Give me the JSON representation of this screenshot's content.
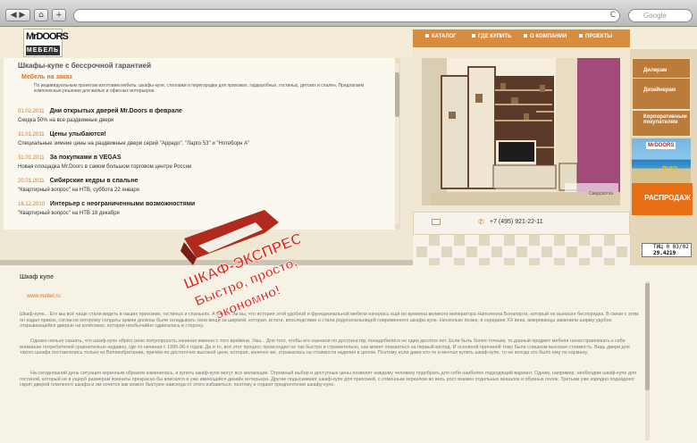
{
  "browser": {
    "search_placeholder": "Google",
    "add_tab": "+",
    "home": "⌂",
    "reload": "C"
  },
  "site": {
    "logo_top": "MrDOORS",
    "logo_bottom": "МЕБЕЛЬ",
    "nav": [
      "КАТАЛОГ",
      "ГДЕ КУПИТЬ",
      "О КОМПАНИИ",
      "ПРОЕКТЫ"
    ],
    "news_title": "Шкафы-купе с бессрочной гарантией",
    "custom_title": "Мебель на заказ",
    "custom_text": "По индивидуальным проектам изготовим мебель: шкафы-купе, стеллажи и перегородки для прихожих, гардеробных, гостиных, детских и спален. Предлагаем комплексные решения для жилых и офисных интерьеров.",
    "news": [
      {
        "date": "01.02.2011",
        "head": "Дни открытых дверей Mr.Doors в феврале",
        "sub": "Скидка 50% на все раздвижные двери"
      },
      {
        "date": "31.01.2011",
        "head": "Цены улыбаются!",
        "sub": "Специальные зимние цены на раздвижные двери серий \"Арредо\", \"Ларго 53\" и \"Нотеборн А\""
      },
      {
        "date": "31.01.2011",
        "head": "За покупками в VEGAS",
        "sub": "Новая площадка Mr.Doors в самом большом торговом центре России"
      },
      {
        "date": "20.01.2011",
        "head": "Сибирские кедры в спальне",
        "sub": "\"Квартирный вопрос\" на НТВ, суббота 22 января"
      },
      {
        "date": "16.12.2010",
        "head": "Интерьер с неограниченными возможностями",
        "sub": "\"Квартирный вопрос\" на НТВ 18 декабря"
      }
    ],
    "side_buttons": [
      "Дилерам",
      "Дизайнерам",
      "Корпоративным покупателям"
    ],
    "beach_label": "MrDOORS",
    "beach_caption": "РИО",
    "sale": "РАСПРОДАЖ",
    "phone": "+7 (495) 921-22-11",
    "photo_caption": "Свидсвотка",
    "counter_top": "ТИЦ 0  03/02",
    "counter_bottom": "29.4219",
    "stamp_line1": "ШКАФ-ЭКСПРЕСС",
    "stamp_line2": "Быстро, просто,",
    "stamp_line3": "экономно!",
    "article_title": "Шкаф купе",
    "article_link": "www.mebel.ru",
    "paragraphs": [
      "Шкаф-купе... Его мы всё чаще стали видеть в наших прихожих, гостиных и спальнях. А знаете ли вы, что история этой удобной и функциональной мебели началась ещё во времена великого императора Наполеона Бонапарта, который не выносил беспорядка. В связи с этим он издал приказ, согласно которому солдаты армии должны были складывать свои вещи за ширмой, которая, кстати, впоследствии и стала родоначальницей современного шкафа-купе. Несколько позже, в середине XX века, американцы заменили ширму удобно открывающейся дверью на колёсиках, которая необычайно сдвигалась в сторону.",
      "Однако нельзя сказать, что шкаф-купе обрёл свою популярность начиная именно с того времени. Увы... Для того, чтобы его оценили по достоинству, понадобилися не один десяток лет. Если быть более точным, то данный предмет мебели начал привлекать к себе внимание потребителей сравнительно недавно, где-то начиная с 1995-96-х годов. Да и то, всё этот процесс происходил не так быстро и стремительно, как может показаться на первый взгляд. И основной причиной тому была слишком высокая стоимость. Ведь двери для такого шкафа поставлялись только из Великобритании, причём по достаточно высокой цене, которая, конечно же, отражалась на стоимости изделия в целом. Поэтому если даже кто-то и мечтал купить шкаф-купе, то не всегда это было ему по карману.",
      "На сегодняшний день ситуация коренным образом изменилась, и купить шкаф-купе могут все желающие. Огромный выбор и доступные цены позволят каждому человеку подобрать для себя наиболее подходящий вариант. Одним, например, необходим шкаф-купе для гостиной, который не в ущерб размерам комнаты прекрасно бы вписался в уже имеющийся дизайн интерьера. Другие подыскивают шкаф-купе для прихожей, с отменным зеркалом во весь рост взамен отдельных вешалок и обувных полок. Третьим уже изрядно поднадоел скрип дверей платяного шкафа и им хочется как можно быстрее навсегда от этого избавиться, поэтому и отдают предпочтение шкафу-купе."
    ],
    "colors": {
      "accent": "#d9731f",
      "nav": "#d68d42",
      "side": "#ba7b3b",
      "stamp_red": "#e02b1e"
    }
  }
}
